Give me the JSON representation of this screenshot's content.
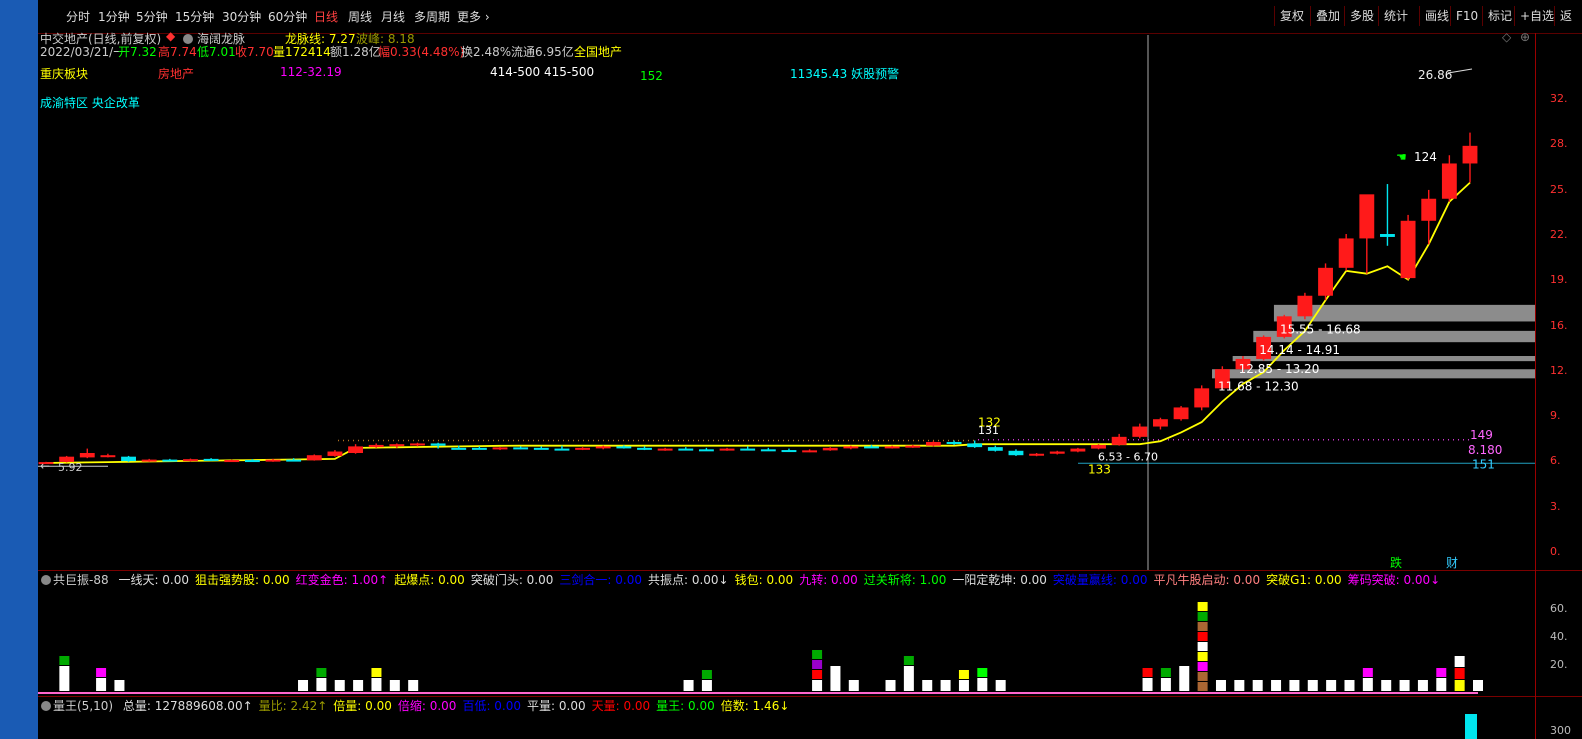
{
  "toolbar": {
    "tabs": [
      "分时",
      "1分钟",
      "5分钟",
      "15分钟",
      "30分钟",
      "60分钟",
      "日线",
      "周线",
      "月线",
      "多周期",
      "更多"
    ],
    "active_tab": "日线",
    "more_icon": "chevron-right-icon",
    "buttons": [
      "复权",
      "叠加",
      "多股",
      "统计",
      "画线",
      "F10",
      "标记",
      "+自选",
      "返"
    ]
  },
  "header": {
    "stock_title": "中交地产(日线,前复权)",
    "indicator_name": "海阔龙脉",
    "dragon_line": "龙脉线: 7.27",
    "wave_peak": "波峰: 8.18",
    "date": "2022/03/21/一",
    "open": "开7.32",
    "high": "高7.74",
    "low": "低7.01",
    "close": "收7.70",
    "volume": "量172414",
    "amount": "额1.28亿",
    "change": "幅0.33(4.48%)",
    "turnover": "换2.48%",
    "float_mv": "流通6.95亿",
    "sector_name": "全国地产",
    "info_sector": "重庆板块",
    "info_industry": "房地产",
    "info_code1": "112-32.19",
    "info_code2": "414-500 415-500",
    "info_num": "152",
    "info_warning": "11345.43 妖股预警",
    "concepts": "成渝特区 央企改革"
  },
  "main_annotations": {
    "peak_label": "26.86",
    "label_124": "124",
    "zone1": "15.55 - 16.68",
    "zone2": "14.14 - 14.91",
    "zone3": "12.85 - 13.20",
    "zone4": "11.68 - 12.30",
    "low_label": "5.92",
    "label_132": "132",
    "label_131": "131",
    "label_133": "133",
    "range_label": "6.53 - 6.70",
    "label_149": "149",
    "label_8180": "8.180",
    "label_151": "151",
    "event_die": "跌",
    "event_cai": "财"
  },
  "price_axis": [
    "32.",
    "28.",
    "25.",
    "22.",
    "19.",
    "16.",
    "12.",
    "9.",
    "6.",
    "3.",
    "0."
  ],
  "indicator1": {
    "title": "共巨振-88",
    "items": [
      {
        "label": "一线天: 0.00",
        "color": "#dddddd"
      },
      {
        "label": "狙击强势股: 0.00",
        "color": "#ffff00"
      },
      {
        "label": "红变金色: 1.00↑",
        "color": "#ff00ff"
      },
      {
        "label": "起爆点: 0.00",
        "color": "#ffff00"
      },
      {
        "label": "突破门头: 0.00",
        "color": "#dddddd"
      },
      {
        "label": "三剑合一: 0.00",
        "color": "#0000ff"
      },
      {
        "label": "共振点: 0.00↓",
        "color": "#dddddd"
      },
      {
        "label": "钱包: 0.00",
        "color": "#ffff00"
      },
      {
        "label": "九转: 0.00",
        "color": "#ff00ff"
      },
      {
        "label": "过关斩将: 1.00",
        "color": "#00ff00"
      },
      {
        "label": "一阳定乾坤: 0.00",
        "color": "#dddddd"
      },
      {
        "label": "突破量赢线: 0.00",
        "color": "#0000ff"
      },
      {
        "label": "平凡牛股启动: 0.00",
        "color": "#ff8080"
      },
      {
        "label": "突破G1: 0.00",
        "color": "#ffff00"
      },
      {
        "label": "筹码突破: 0.00↓",
        "color": "#ff00ff"
      }
    ],
    "axis": [
      "60.",
      "40.",
      "20."
    ]
  },
  "indicator2": {
    "title": "量王(5,10)",
    "items": [
      {
        "label": "总量: 127889608.00↑",
        "color": "#dddddd"
      },
      {
        "label": "量比: 2.42↑",
        "color": "#999900"
      },
      {
        "label": "倍量: 0.00",
        "color": "#ffff00"
      },
      {
        "label": "倍缩: 0.00",
        "color": "#ff00ff"
      },
      {
        "label": "百低: 0.00",
        "color": "#0000ff"
      },
      {
        "label": "平量: 0.00",
        "color": "#dddddd"
      },
      {
        "label": "天量: 0.00",
        "color": "#ff0000"
      },
      {
        "label": "量王: 0.00",
        "color": "#00ff00"
      },
      {
        "label": "倍数: 1.46↓",
        "color": "#ffff00"
      }
    ],
    "axis": [
      "300"
    ]
  },
  "chart_data": {
    "type": "candlestick",
    "interval": "日线",
    "adjust": "前复权",
    "candles": [
      {
        "o": 5.95,
        "h": 6.0,
        "l": 5.92,
        "c": 5.98
      },
      {
        "o": 6.0,
        "h": 6.4,
        "l": 5.96,
        "c": 6.35
      },
      {
        "o": 6.3,
        "h": 6.9,
        "l": 6.25,
        "c": 6.6
      },
      {
        "o": 6.4,
        "h": 6.55,
        "l": 6.3,
        "c": 6.45
      },
      {
        "o": 6.35,
        "h": 6.4,
        "l": 6.0,
        "c": 6.05
      },
      {
        "o": 6.1,
        "h": 6.2,
        "l": 6.0,
        "c": 6.15
      },
      {
        "o": 6.15,
        "h": 6.2,
        "l": 6.05,
        "c": 6.1
      },
      {
        "o": 6.1,
        "h": 6.22,
        "l": 6.02,
        "c": 6.18
      },
      {
        "o": 6.2,
        "h": 6.25,
        "l": 6.05,
        "c": 6.08
      },
      {
        "o": 6.08,
        "h": 6.15,
        "l": 6.0,
        "c": 6.12
      },
      {
        "o": 6.12,
        "h": 6.18,
        "l": 6.02,
        "c": 6.06
      },
      {
        "o": 6.06,
        "h": 6.2,
        "l": 6.0,
        "c": 6.15
      },
      {
        "o": 6.15,
        "h": 6.25,
        "l": 6.05,
        "c": 6.1
      },
      {
        "o": 6.1,
        "h": 6.5,
        "l": 6.08,
        "c": 6.45
      },
      {
        "o": 6.4,
        "h": 6.8,
        "l": 6.35,
        "c": 6.7
      },
      {
        "o": 6.6,
        "h": 7.2,
        "l": 6.55,
        "c": 7.05
      },
      {
        "o": 7.0,
        "h": 7.25,
        "l": 6.95,
        "c": 7.15
      },
      {
        "o": 7.1,
        "h": 7.25,
        "l": 6.95,
        "c": 7.2
      },
      {
        "o": 7.15,
        "h": 7.3,
        "l": 7.05,
        "c": 7.25
      },
      {
        "o": 7.25,
        "h": 7.3,
        "l": 6.9,
        "c": 7.1
      },
      {
        "o": 6.95,
        "h": 7.1,
        "l": 6.85,
        "c": 6.9
      },
      {
        "o": 6.95,
        "h": 7.05,
        "l": 6.85,
        "c": 6.9
      },
      {
        "o": 6.9,
        "h": 7.0,
        "l": 6.8,
        "c": 6.98
      },
      {
        "o": 6.98,
        "h": 7.05,
        "l": 6.85,
        "c": 6.95
      },
      {
        "o": 6.95,
        "h": 7.05,
        "l": 6.85,
        "c": 6.9
      },
      {
        "o": 6.9,
        "h": 7.1,
        "l": 6.8,
        "c": 6.85
      },
      {
        "o": 6.85,
        "h": 7.0,
        "l": 6.8,
        "c": 6.95
      },
      {
        "o": 6.95,
        "h": 7.1,
        "l": 6.85,
        "c": 7.05
      },
      {
        "o": 7.05,
        "h": 7.12,
        "l": 6.9,
        "c": 6.95
      },
      {
        "o": 6.95,
        "h": 7.05,
        "l": 6.8,
        "c": 6.85
      },
      {
        "o": 6.85,
        "h": 6.95,
        "l": 6.75,
        "c": 6.9
      },
      {
        "o": 6.9,
        "h": 7.0,
        "l": 6.8,
        "c": 6.85
      },
      {
        "o": 6.85,
        "h": 6.95,
        "l": 6.75,
        "c": 6.8
      },
      {
        "o": 6.8,
        "h": 6.95,
        "l": 6.75,
        "c": 6.9
      },
      {
        "o": 6.9,
        "h": 7.05,
        "l": 6.8,
        "c": 6.85
      },
      {
        "o": 6.85,
        "h": 6.95,
        "l": 6.75,
        "c": 6.8
      },
      {
        "o": 6.8,
        "h": 6.9,
        "l": 6.7,
        "c": 6.75
      },
      {
        "o": 6.75,
        "h": 6.85,
        "l": 6.65,
        "c": 6.78
      },
      {
        "o": 6.78,
        "h": 7.0,
        "l": 6.75,
        "c": 6.95
      },
      {
        "o": 6.95,
        "h": 7.1,
        "l": 6.85,
        "c": 7.05
      },
      {
        "o": 7.05,
        "h": 7.15,
        "l": 6.95,
        "c": 7.0
      },
      {
        "o": 7.0,
        "h": 7.1,
        "l": 6.9,
        "c": 7.05
      },
      {
        "o": 7.05,
        "h": 7.15,
        "l": 6.95,
        "c": 7.1
      },
      {
        "o": 7.1,
        "h": 7.4,
        "l": 7.05,
        "c": 7.35
      },
      {
        "o": 7.35,
        "h": 7.45,
        "l": 7.15,
        "c": 7.25
      },
      {
        "o": 7.25,
        "h": 7.45,
        "l": 6.95,
        "c": 7.0
      },
      {
        "o": 7.0,
        "h": 7.1,
        "l": 6.7,
        "c": 6.75
      },
      {
        "o": 6.75,
        "h": 6.85,
        "l": 6.4,
        "c": 6.45
      },
      {
        "o": 6.5,
        "h": 6.6,
        "l": 6.38,
        "c": 6.55
      },
      {
        "o": 6.55,
        "h": 6.75,
        "l": 6.5,
        "c": 6.7
      },
      {
        "o": 6.7,
        "h": 6.95,
        "l": 6.65,
        "c": 6.9
      },
      {
        "o": 6.9,
        "h": 7.2,
        "l": 6.85,
        "c": 7.15
      },
      {
        "o": 7.15,
        "h": 7.9,
        "l": 7.1,
        "c": 7.7
      },
      {
        "o": 7.7,
        "h": 8.6,
        "l": 7.6,
        "c": 8.4
      },
      {
        "o": 8.4,
        "h": 9.0,
        "l": 8.2,
        "c": 8.9
      },
      {
        "o": 8.9,
        "h": 9.8,
        "l": 8.8,
        "c": 9.7
      },
      {
        "o": 9.7,
        "h": 11.2,
        "l": 9.5,
        "c": 11.0
      },
      {
        "o": 11.0,
        "h": 12.5,
        "l": 10.9,
        "c": 12.3
      },
      {
        "o": 12.3,
        "h": 13.2,
        "l": 12.1,
        "c": 13.0
      },
      {
        "o": 13.0,
        "h": 14.6,
        "l": 12.9,
        "c": 14.5
      },
      {
        "o": 14.5,
        "h": 16.0,
        "l": 14.4,
        "c": 15.9
      },
      {
        "o": 15.9,
        "h": 17.5,
        "l": 15.7,
        "c": 17.3
      },
      {
        "o": 17.3,
        "h": 19.5,
        "l": 17.0,
        "c": 19.2
      },
      {
        "o": 19.2,
        "h": 21.5,
        "l": 19.0,
        "c": 21.2
      },
      {
        "o": 21.2,
        "h": 24.0,
        "l": 18.8,
        "c": 24.2
      },
      {
        "o": 21.5,
        "h": 24.9,
        "l": 20.7,
        "c": 21.3
      },
      {
        "o": 18.5,
        "h": 22.8,
        "l": 18.4,
        "c": 22.4
      },
      {
        "o": 22.4,
        "h": 24.5,
        "l": 20.8,
        "c": 23.9
      },
      {
        "o": 23.9,
        "h": 26.86,
        "l": 23.7,
        "c": 26.3
      },
      {
        "o": 26.3,
        "h": 28.4,
        "l": 25.0,
        "c": 27.5
      }
    ],
    "ylim": [
      0,
      33
    ]
  }
}
